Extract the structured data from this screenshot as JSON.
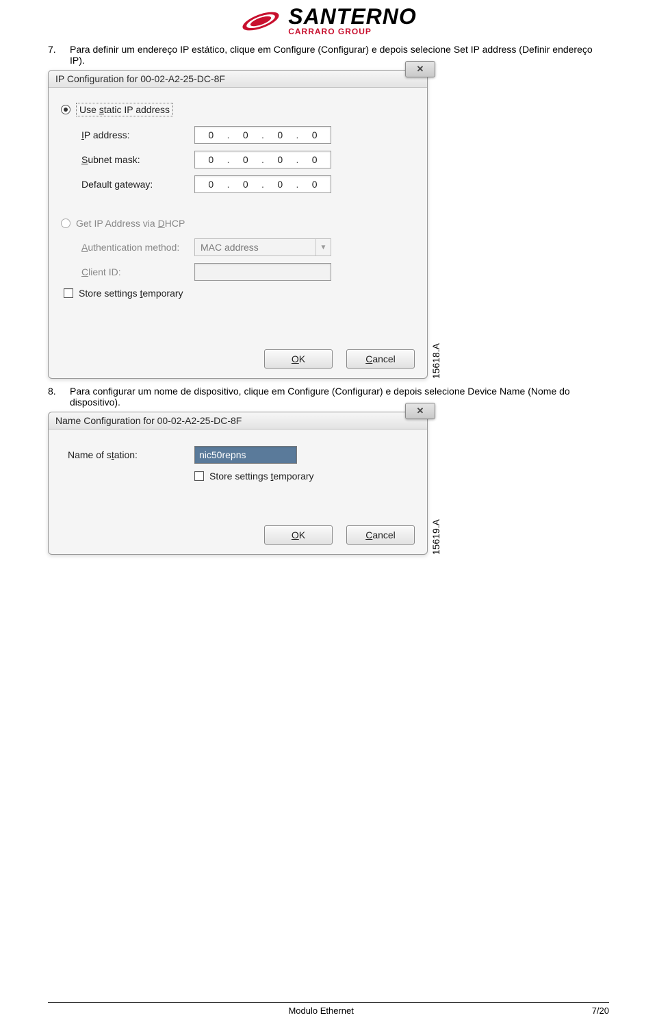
{
  "header": {
    "brand": "SANTERNO",
    "subtitle": "CARRARO GROUP"
  },
  "step7": {
    "num": "7.",
    "text": "Para definir um endereço IP estático, clique em Configure (Configurar) e depois selecione Set IP address (Definir endereço IP)."
  },
  "dialog1": {
    "title": "IP Configuration for 00-02-A2-25-DC-8F",
    "radio_static": "Use static IP address",
    "static_s": "s",
    "ip_label": "IP address:",
    "ip_label_ul": "I",
    "subnet_label": "Subnet mask:",
    "subnet_ul": "S",
    "gateway_label": "Default gateway:",
    "gateway_ul": "g",
    "ip": [
      "0",
      "0",
      "0",
      "0"
    ],
    "subnet": [
      "0",
      "0",
      "0",
      "0"
    ],
    "gateway": [
      "0",
      "0",
      "0",
      "0"
    ],
    "radio_dhcp": "Get IP Address via DHCP",
    "dhcp_ul": "D",
    "auth_label": "Authentication method:",
    "auth_ul": "A",
    "auth_value": "MAC address",
    "client_label": "Client ID:",
    "client_ul": "C",
    "store_label": "Store settings temporary",
    "store_ul": "t",
    "ok": "OK",
    "ok_ul": "O",
    "cancel": "Cancel",
    "cancel_ul": "C",
    "figure_label": "15618.A"
  },
  "step8": {
    "num": "8.",
    "text": "Para configurar um nome de dispositivo, clique em Configure (Configurar) e depois selecione Device Name (Nome do dispositivo)."
  },
  "dialog2": {
    "title": "Name Configuration for 00-02-A2-25-DC-8F",
    "name_label": "Name of station:",
    "name_ul": "t",
    "name_value": "nic50repns",
    "store_label": "Store settings temporary",
    "store_ul": "t",
    "ok": "OK",
    "ok_ul": "O",
    "cancel": "Cancel",
    "cancel_ul": "C",
    "figure_label": "15619.A"
  },
  "footer": {
    "center": "Modulo Ethernet",
    "right": "7/20"
  }
}
